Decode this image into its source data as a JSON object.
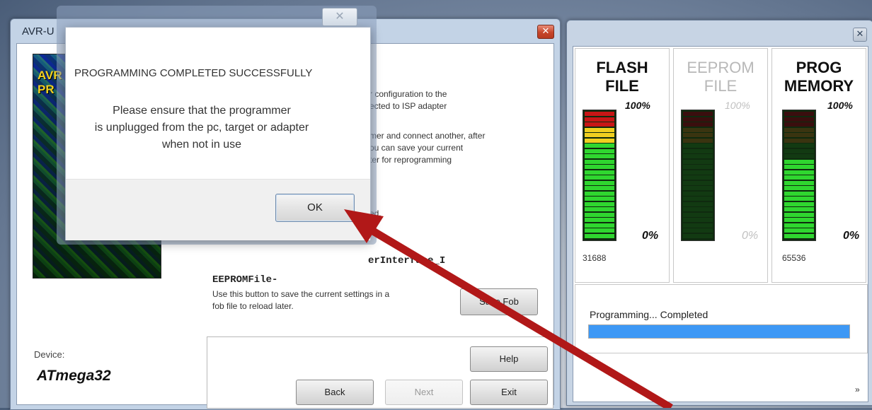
{
  "main_window": {
    "title": "AVR-U",
    "close_glyph": "✕",
    "banner_text": "AVR\nPR",
    "config_text": "r configuration to the\nected to ISP adapter",
    "connect_text": "mer and connect another, after\nou can save your current\nter for reprogramming",
    "status_tail": "ed.",
    "code_line": "erInterface_I",
    "eeprom_label": "EEPROMFile-",
    "fob_description": "Use this button to save the current settings in a\nfob file to reload later.",
    "save_fob_label": "Save Fob",
    "help_label": "Help",
    "back_label": "Back",
    "next_label": "Next",
    "exit_label": "Exit",
    "device_label": "Device:",
    "device_name": "ATmega32"
  },
  "progress_window": {
    "close_glyph": "✕",
    "meters": [
      {
        "title_line1": "FLASH",
        "title_line2": "FILE",
        "top_label": "100%",
        "bottom_label": "0%",
        "count": "31688",
        "active": true,
        "fill_fraction": 1.0
      },
      {
        "title_line1": "EEPROM",
        "title_line2": "FILE",
        "top_label": "100%",
        "bottom_label": "0%",
        "count": "",
        "active": false,
        "fill_fraction": 0.0
      },
      {
        "title_line1": "PROG",
        "title_line2": "MEMORY",
        "top_label": "100%",
        "bottom_label": "0%",
        "count": "65536",
        "active": true,
        "fill_fraction": 0.62
      }
    ],
    "status_text": "Programming... Completed",
    "progress_fraction": 1.0,
    "expand_glyph": "»"
  },
  "message_box": {
    "close_glyph": "✕",
    "heading": "PROGRAMMING COMPLETED SUCCESSFULLY",
    "body": "Please ensure that the programmer\nis unplugged from the pc, target or adapter\nwhen not in use",
    "ok_label": "OK"
  },
  "colors": {
    "arrow": "#b11818",
    "progress_fill": "#3d98f5"
  }
}
